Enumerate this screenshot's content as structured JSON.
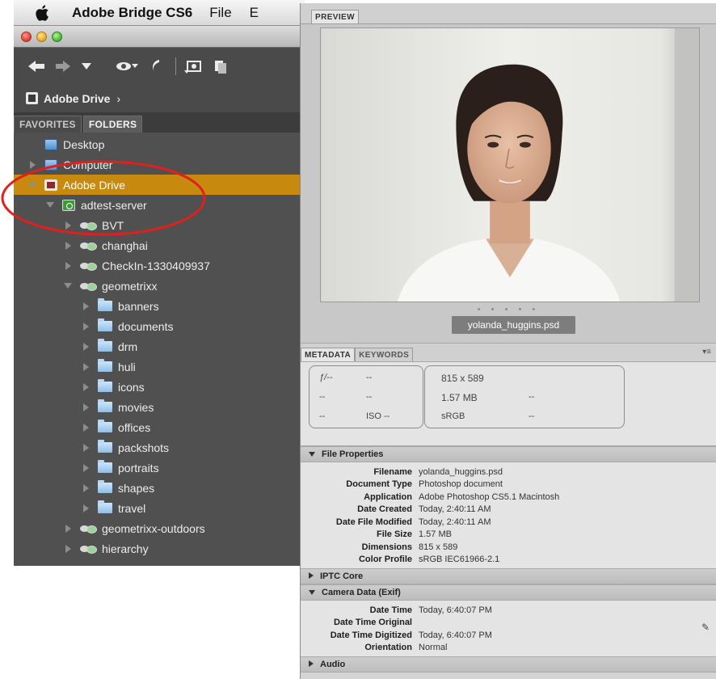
{
  "menubar": {
    "app": "Adobe Bridge CS6",
    "items": [
      "File",
      "E"
    ]
  },
  "path": {
    "label": "Adobe Drive",
    "chevron": "›"
  },
  "panel_tabs": {
    "favorites": "FAVORITES",
    "folders": "FOLDERS"
  },
  "tree": [
    {
      "label": "Desktop",
      "icon": "desktop-icon",
      "level": 0,
      "arrow": "none"
    },
    {
      "label": "Computer",
      "icon": "computer-icon",
      "level": 0,
      "arrow": "right"
    },
    {
      "label": "Adobe Drive",
      "icon": "drive-icon",
      "level": 0,
      "arrow": "down",
      "selected": true
    },
    {
      "label": "adtest-server",
      "icon": "server-icon",
      "level": 1,
      "arrow": "down"
    },
    {
      "label": "BVT",
      "icon": "share-icon",
      "level": 2,
      "arrow": "right"
    },
    {
      "label": "changhai",
      "icon": "share-icon",
      "level": 2,
      "arrow": "right"
    },
    {
      "label": "CheckIn-1330409937",
      "icon": "share-icon",
      "level": 2,
      "arrow": "right"
    },
    {
      "label": "geometrixx",
      "icon": "share-icon",
      "level": 2,
      "arrow": "down"
    },
    {
      "label": "banners",
      "icon": "folder-icon",
      "level": 3,
      "arrow": "right"
    },
    {
      "label": "documents",
      "icon": "folder-icon",
      "level": 3,
      "arrow": "right"
    },
    {
      "label": "drm",
      "icon": "folder-icon",
      "level": 3,
      "arrow": "right"
    },
    {
      "label": "huli",
      "icon": "folder-icon",
      "level": 3,
      "arrow": "right"
    },
    {
      "label": "icons",
      "icon": "folder-icon",
      "level": 3,
      "arrow": "right"
    },
    {
      "label": "movies",
      "icon": "folder-icon",
      "level": 3,
      "arrow": "right"
    },
    {
      "label": "offices",
      "icon": "folder-icon",
      "level": 3,
      "arrow": "right"
    },
    {
      "label": "packshots",
      "icon": "folder-icon",
      "level": 3,
      "arrow": "right"
    },
    {
      "label": "portraits",
      "icon": "folder-icon",
      "level": 3,
      "arrow": "right"
    },
    {
      "label": "shapes",
      "icon": "folder-icon",
      "level": 3,
      "arrow": "right"
    },
    {
      "label": "travel",
      "icon": "folder-icon",
      "level": 3,
      "arrow": "right"
    },
    {
      "label": "geometrixx-outdoors",
      "icon": "share-icon",
      "level": 2,
      "arrow": "right"
    },
    {
      "label": "hierarchy",
      "icon": "share-icon",
      "level": 2,
      "arrow": "right"
    }
  ],
  "preview": {
    "tab": "PREVIEW",
    "filename": "yolanda_huggins.psd",
    "dots": "• • • • •"
  },
  "metadata_tabs": {
    "metadata": "METADATA",
    "keywords": "KEYWORDS"
  },
  "camera": {
    "fstop": "ƒ/--",
    "shutter": "--",
    "r2c1": "--",
    "r2c2": "--",
    "r3c1": "--",
    "iso": "ISO --",
    "dimensions": "815 x 589",
    "size": "1.57 MB",
    "size_extra": "--",
    "color": "sRGB",
    "color_extra": "--"
  },
  "sections": {
    "file_properties": "File Properties",
    "iptc": "IPTC Core",
    "camera": "Camera Data (Exif)",
    "audio": "Audio"
  },
  "file_properties": [
    {
      "key": "Filename",
      "value": "yolanda_huggins.psd"
    },
    {
      "key": "Document Type",
      "value": "Photoshop document"
    },
    {
      "key": "Application",
      "value": "Adobe Photoshop CS5.1 Macintosh"
    },
    {
      "key": "Date Created",
      "value": "Today, 2:40:11 AM"
    },
    {
      "key": "Date File Modified",
      "value": "Today, 2:40:11 AM"
    },
    {
      "key": "File Size",
      "value": "1.57 MB"
    },
    {
      "key": "Dimensions",
      "value": "815 x 589"
    },
    {
      "key": "Color Profile",
      "value": "sRGB IEC61966-2.1"
    }
  ],
  "exif": [
    {
      "key": "Date Time",
      "value": "Today, 6:40:07 PM"
    },
    {
      "key": "Date Time Original",
      "value": ""
    },
    {
      "key": "Date Time Digitized",
      "value": "Today, 6:40:07 PM"
    },
    {
      "key": "Orientation",
      "value": "Normal"
    }
  ],
  "colors": {
    "selection": "#c8890f",
    "annotation": "#e0201e",
    "panel_dark": "#505050"
  }
}
